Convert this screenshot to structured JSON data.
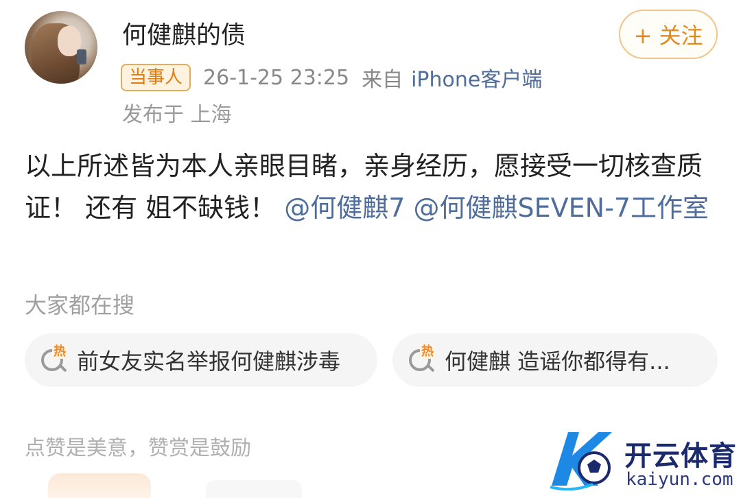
{
  "post": {
    "username": "何健麒的债",
    "follow_label": "+ 关注",
    "badge": "当事人",
    "time": "26-1-25 23:25",
    "from_label": "来自",
    "device": "iPhone客户端",
    "location": "发布于 上海",
    "body_text": "以上所述皆为本人亲眼目睹，亲身经历，愿接受一切核查质证！  还有 姐不缺钱！",
    "mentions": [
      "@何健麒7",
      "@何健麒SEVEN-7工作室"
    ]
  },
  "search": {
    "section_title": "大家都在搜",
    "hot_tag": "热",
    "chips": [
      {
        "text": "前女友实名举报何健麒涉毒"
      },
      {
        "text": "何健麒 造谣你都得有..."
      }
    ]
  },
  "reward": {
    "text": "点赞是美意，赞赏是鼓励"
  },
  "watermark": {
    "title": "开云体育",
    "url": "kaiyun.com"
  },
  "colors": {
    "accent_orange": "#e08a1e",
    "link_blue": "#4f6d9a",
    "watermark_navy": "#1a2a6c"
  }
}
